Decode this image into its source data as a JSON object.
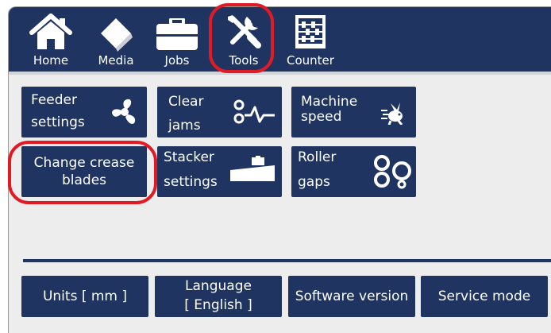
{
  "nav": {
    "home": {
      "label": "Home",
      "icon": "home-icon"
    },
    "media": {
      "label": "Media",
      "icon": "media-icon"
    },
    "jobs": {
      "label": "Jobs",
      "icon": "briefcase-icon"
    },
    "tools": {
      "label": "Tools",
      "icon": "tools-icon"
    },
    "counter": {
      "label": "Counter",
      "icon": "abacus-icon"
    }
  },
  "tiles": {
    "feeder": {
      "line1": "Feeder",
      "line2": "settings",
      "icon": "fan-icon"
    },
    "clear_jams": {
      "line1": "Clear",
      "line2": "jams",
      "icon": "jam-icon"
    },
    "machine_speed": {
      "line1": "Machine",
      "line2": "speed",
      "icon": "rabbit-icon"
    },
    "change_crease": {
      "line1": "Change crease",
      "line2": "blades"
    },
    "stacker": {
      "line1": "Stacker",
      "line2": "settings",
      "icon": "stacker-icon"
    },
    "roller_gaps": {
      "line1": "Roller",
      "line2": "gaps",
      "icon": "rollers-icon"
    }
  },
  "bottom": {
    "units": "Units [ mm ]",
    "language_line1": "Language",
    "language_line2": "[ English ]",
    "software_version": "Software version",
    "service_mode": "Service mode"
  },
  "colors": {
    "accent": "#1f3461",
    "highlight": "#e01b24",
    "background": "#ededed"
  }
}
